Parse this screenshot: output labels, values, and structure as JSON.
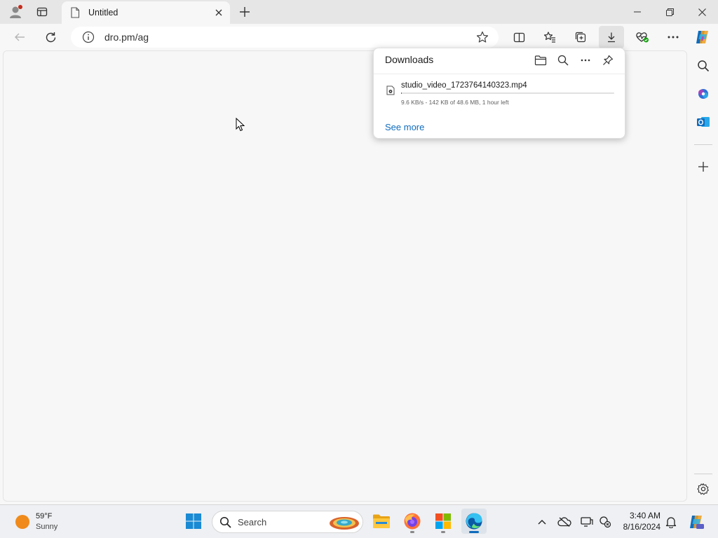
{
  "browser": {
    "tab": {
      "title": "Untitled"
    },
    "address": {
      "url": "dro.pm/ag"
    }
  },
  "downloads": {
    "title": "Downloads",
    "item": {
      "filename": "studio_video_1723764140323.mp4",
      "status": "9.6 KB/s - 142 KB of 48.6 MB, 1 hour left",
      "progress_fraction": 0.003
    },
    "see_more": "See more"
  },
  "taskbar": {
    "weather": {
      "temp": "59°F",
      "condition": "Sunny"
    },
    "search_label": "Search",
    "clock": {
      "time": "3:40 AM",
      "date": "8/16/2024"
    }
  },
  "colors": {
    "accent": "#0f6cbd",
    "chrome_bg": "#e6e6e6",
    "page_bg": "#f7f7f7"
  },
  "icons": [
    "profile-icon",
    "tab-actions-icon",
    "page-icon",
    "close-icon",
    "plus-icon",
    "minimize-icon",
    "maximize-icon",
    "back-icon",
    "refresh-icon",
    "info-icon",
    "star-icon",
    "split-screen-icon",
    "favorites-icon",
    "collections-icon",
    "download-icon",
    "browser-essentials-icon",
    "more-icon",
    "copilot-icon",
    "folder-icon",
    "search-icon",
    "pin-icon",
    "video-file-icon",
    "outlook-icon",
    "gear-icon",
    "windows-start-icon",
    "file-explorer-icon",
    "firefox-icon",
    "ms-store-icon",
    "edge-icon",
    "chevron-up-icon",
    "cloud-icon",
    "bell-icon"
  ]
}
